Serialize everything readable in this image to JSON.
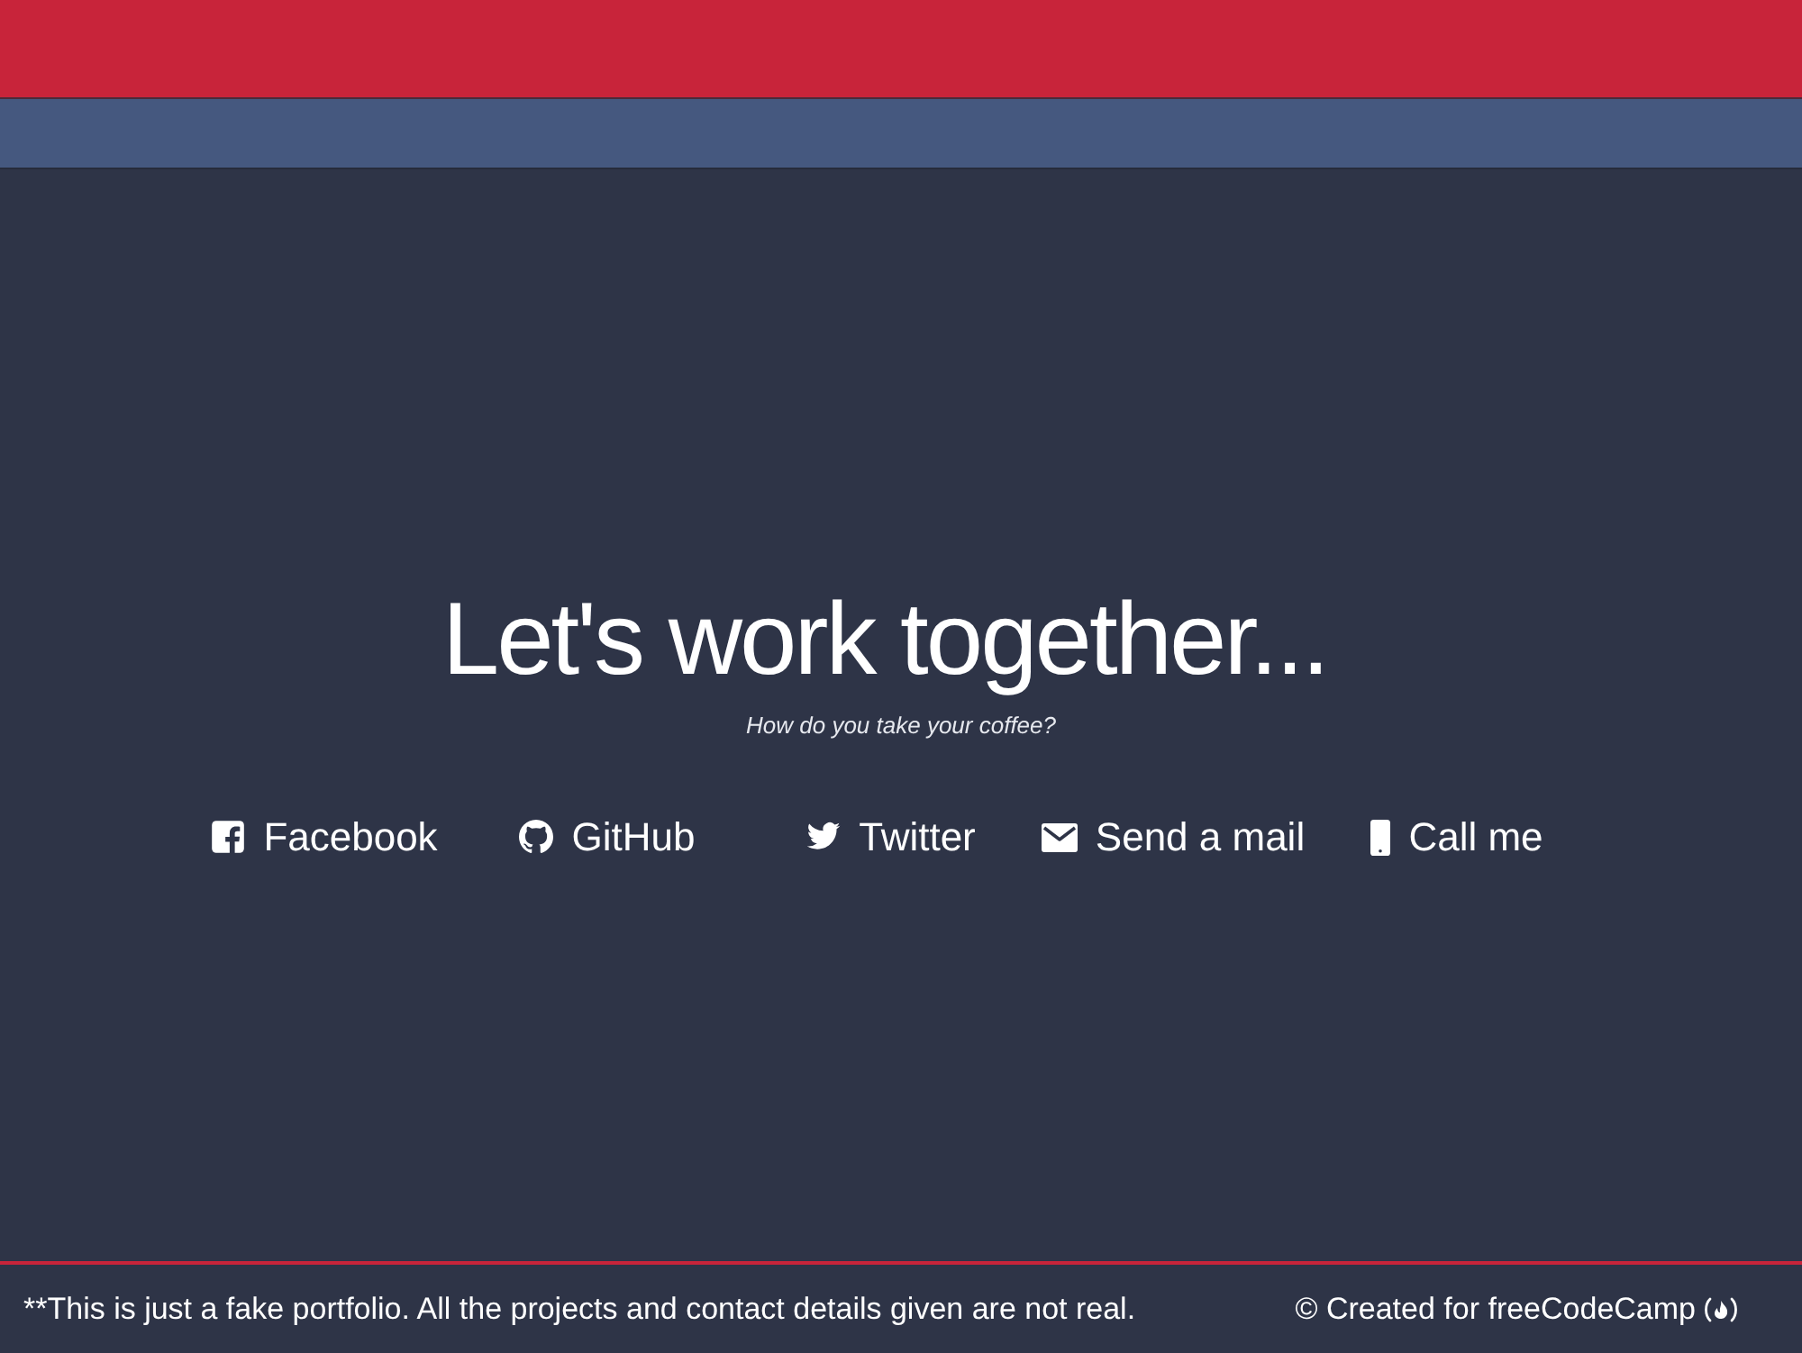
{
  "hero": {
    "title": "Let's work together...",
    "subtitle": "How do you take your coffee?"
  },
  "contact_links": [
    {
      "label": "Facebook",
      "kind": "facebook"
    },
    {
      "label": "GitHub",
      "kind": "github"
    },
    {
      "label": "Twitter",
      "kind": "twitter"
    },
    {
      "label": "Send a mail",
      "kind": "mail"
    },
    {
      "label": "Call me",
      "kind": "phone"
    }
  ],
  "footer": {
    "disclaimer": "**This is just a fake portfolio. All the projects and contact details given are not real.",
    "credit": "© Created for freeCodeCamp"
  }
}
